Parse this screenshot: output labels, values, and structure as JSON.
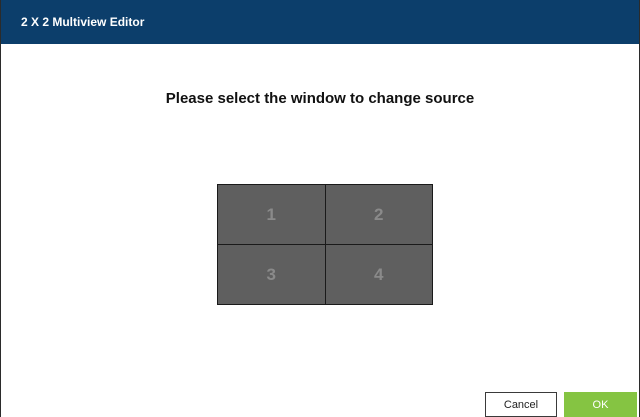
{
  "dialog": {
    "title": "2 X 2 Multiview Editor",
    "prompt": "Please select the window to change source",
    "windows": [
      "1",
      "2",
      "3",
      "4"
    ],
    "buttons": {
      "cancel_label": "Cancel",
      "ok_label": "OK"
    }
  },
  "colors": {
    "titlebar": "#0c3e6b",
    "window_cell": "#5f5f5f",
    "window_number": "#8a8a8a",
    "ok_button": "#85c442"
  }
}
